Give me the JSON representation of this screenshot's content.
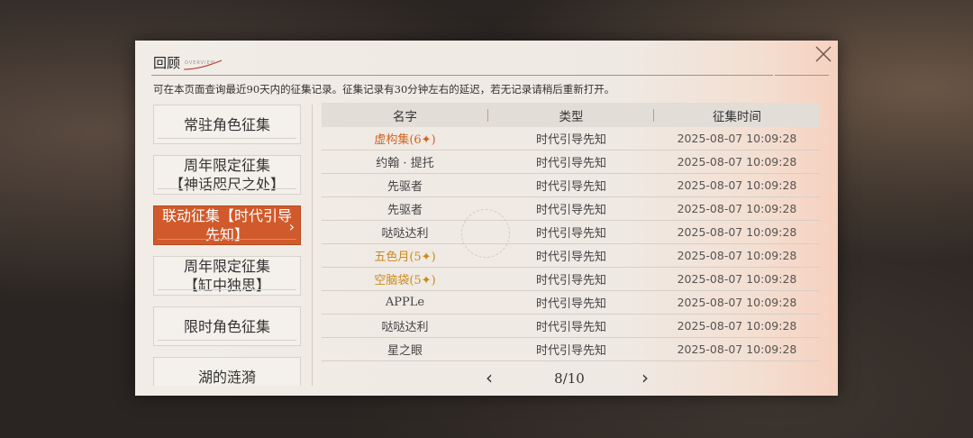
{
  "header": {
    "title": "回顾",
    "subtitle": "OVERVIEW"
  },
  "notice": "可在本页面查询最近90天内的征集记录。征集记录有30分钟左右的延迟，若无记录请稍后重新打开。",
  "sidebar": {
    "items": [
      {
        "line1": "常驻角色征集",
        "line2": "",
        "active": false
      },
      {
        "line1": "周年限定征集",
        "line2": "【神话咫尺之处】",
        "active": false
      },
      {
        "line1": "联动征集【时代引导",
        "line2": "先知】",
        "active": true
      },
      {
        "line1": "周年限定征集",
        "line2": "【缸中独思】",
        "active": false
      },
      {
        "line1": "限时角色征集",
        "line2": "",
        "active": false
      },
      {
        "line1": "湖的涟漪",
        "line2": "",
        "active": false
      }
    ],
    "deco_text": "OVERVIEW"
  },
  "table": {
    "headers": [
      "名字",
      "类型",
      "征集时间"
    ],
    "rows": [
      {
        "name": "虚构集(6",
        "star": "✦",
        "suffix": ")",
        "rarity": 6,
        "type": "时代引导先知",
        "time": "2025-08-07 10:09:28"
      },
      {
        "name": "约翰 · 提托",
        "star": "",
        "suffix": "",
        "rarity": 0,
        "type": "时代引导先知",
        "time": "2025-08-07 10:09:28"
      },
      {
        "name": "先驱者",
        "star": "",
        "suffix": "",
        "rarity": 0,
        "type": "时代引导先知",
        "time": "2025-08-07 10:09:28"
      },
      {
        "name": "先驱者",
        "star": "",
        "suffix": "",
        "rarity": 0,
        "type": "时代引导先知",
        "time": "2025-08-07 10:09:28"
      },
      {
        "name": "哒哒达利",
        "star": "",
        "suffix": "",
        "rarity": 0,
        "type": "时代引导先知",
        "time": "2025-08-07 10:09:28"
      },
      {
        "name": "五色月(5",
        "star": "✦",
        "suffix": ")",
        "rarity": 5,
        "type": "时代引导先知",
        "time": "2025-08-07 10:09:28"
      },
      {
        "name": "空脑袋(5",
        "star": "✦",
        "suffix": ")",
        "rarity": 5,
        "type": "时代引导先知",
        "time": "2025-08-07 10:09:28"
      },
      {
        "name": "APPLe",
        "star": "",
        "suffix": "",
        "rarity": 0,
        "type": "时代引导先知",
        "time": "2025-08-07 10:09:28"
      },
      {
        "name": "哒哒达利",
        "star": "",
        "suffix": "",
        "rarity": 0,
        "type": "时代引导先知",
        "time": "2025-08-07 10:09:28"
      },
      {
        "name": "星之眼",
        "star": "",
        "suffix": "",
        "rarity": 0,
        "type": "时代引导先知",
        "time": "2025-08-07 10:09:28"
      }
    ]
  },
  "pager": {
    "prev": "‹",
    "next": "›",
    "current": "8/10"
  },
  "icons": {
    "close": "close-icon",
    "prev": "chevron-left-icon",
    "next": "chevron-right-icon"
  },
  "colors": {
    "rarity6": "#d2641e",
    "rarity5": "#c88a1c",
    "active": "#d05a2b"
  }
}
